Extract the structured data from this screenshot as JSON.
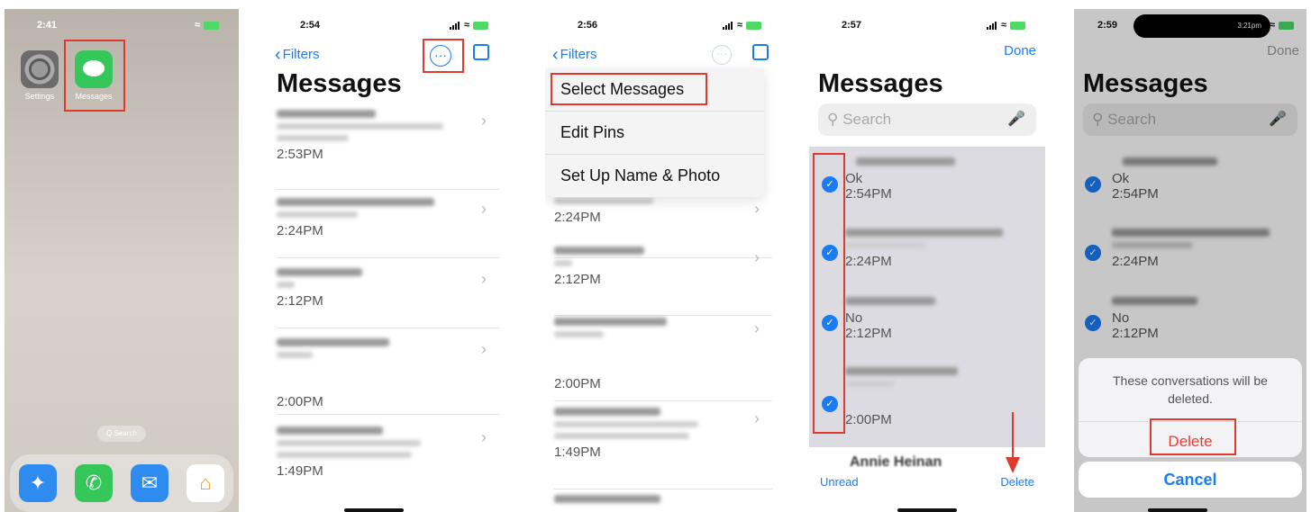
{
  "colors": {
    "ios_blue": "#1a7cf5",
    "highlight_red": "#e03a2f",
    "messages_green": "#35c759"
  },
  "panel1": {
    "time": "2:41",
    "apps": [
      {
        "label": "Settings",
        "icon": "gear-icon"
      },
      {
        "label": "Messages",
        "icon": "message-bubble-icon"
      }
    ],
    "search_pill": "Q Search",
    "dock": [
      "compass-icon",
      "phone-icon",
      "mail-icon",
      "home-icon"
    ]
  },
  "panel2": {
    "time": "2:54",
    "back_label": "Filters",
    "title": "Messages",
    "rows": [
      {
        "time": "2:53PM"
      },
      {
        "time": "2:24PM"
      },
      {
        "time": "2:12PM"
      },
      {
        "time": ""
      },
      {
        "time": "2:00PM"
      },
      {
        "time": "1:49PM"
      }
    ]
  },
  "panel3": {
    "time": "2:56",
    "back_label": "Filters",
    "menu": [
      "Select Messages",
      "Edit Pins",
      "Set Up Name & Photo"
    ],
    "rows": [
      {
        "time": "2:24PM"
      },
      {
        "time": "2:12PM"
      },
      {
        "time": "2:00PM"
      },
      {
        "time": "1:49PM"
      }
    ]
  },
  "panel4": {
    "time": "2:57",
    "done_label": "Done",
    "title": "Messages",
    "search_placeholder": "Search",
    "rows": [
      {
        "snippet": "Ok",
        "time": "2:54PM"
      },
      {
        "snippet": "",
        "time": "2:24PM"
      },
      {
        "snippet": "No",
        "time": "2:12PM"
      },
      {
        "snippet": "",
        "time": "2:00PM"
      }
    ],
    "partial_name": "Annie Heinan",
    "unread_label": "Unread",
    "delete_label": "Delete"
  },
  "panel5": {
    "time": "2:59",
    "island_text": "3:21pm",
    "done_label": "Done",
    "title": "Messages",
    "search_placeholder": "Search",
    "rows": [
      {
        "snippet": "Ok",
        "time": "2:54PM"
      },
      {
        "snippet": "",
        "time": "2:24PM"
      },
      {
        "snippet": "No",
        "time": "2:12PM"
      }
    ],
    "alert_message": "These conversations will be deleted.",
    "alert_delete": "Delete",
    "alert_cancel": "Cancel"
  }
}
